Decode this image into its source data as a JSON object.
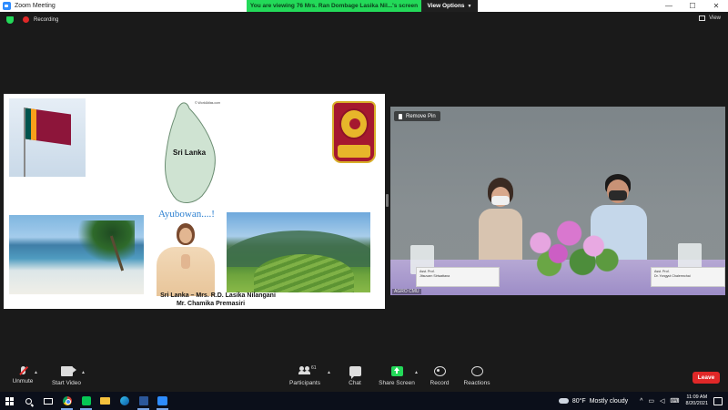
{
  "window": {
    "title": "Zoom Meeting",
    "minimize": "—",
    "maximize": "☐",
    "close": "✕"
  },
  "banner": {
    "viewing_text": "You are viewing 76 Mrs. Ran Dombage Lasika Nil...'s screen",
    "view_options": "View Options"
  },
  "status": {
    "recording_label": "Recording",
    "view_label": "View"
  },
  "shared_slide": {
    "map_credit": "© WorldAtlas.com",
    "map_label": "Sri Lanka",
    "greeting": "Ayubowan....!",
    "caption_line1": "Sri Lanka – Mrs. R.D. Lasika Nilangani",
    "caption_line2": "Mr. Chamika Premasiri"
  },
  "video": {
    "remove_pin_label": "Remove Pin",
    "placard_left_line1": "Asst. Prof.",
    "placard_left_line2": "Jitsuvarn Siriwattana",
    "placard_right_line1": "Asst. Prof.",
    "placard_right_line2": "Dr. Yongyut Chalermchai",
    "watermark": "AGRO CMU"
  },
  "toolbar": {
    "unmute": "Unmute",
    "start_video": "Start Video",
    "participants": "Participants",
    "participants_count": "61",
    "chat": "Chat",
    "share_screen": "Share Screen",
    "record": "Record",
    "reactions": "Reactions",
    "leave": "Leave"
  },
  "taskbar": {
    "weather_temp": "80°F",
    "weather_desc": "Mostly cloudy",
    "time": "11:09 AM",
    "date": "8/20/2021"
  },
  "colors": {
    "zoom_blue": "#2d8cff",
    "share_green": "#23d959",
    "leave_red": "#e02828"
  }
}
